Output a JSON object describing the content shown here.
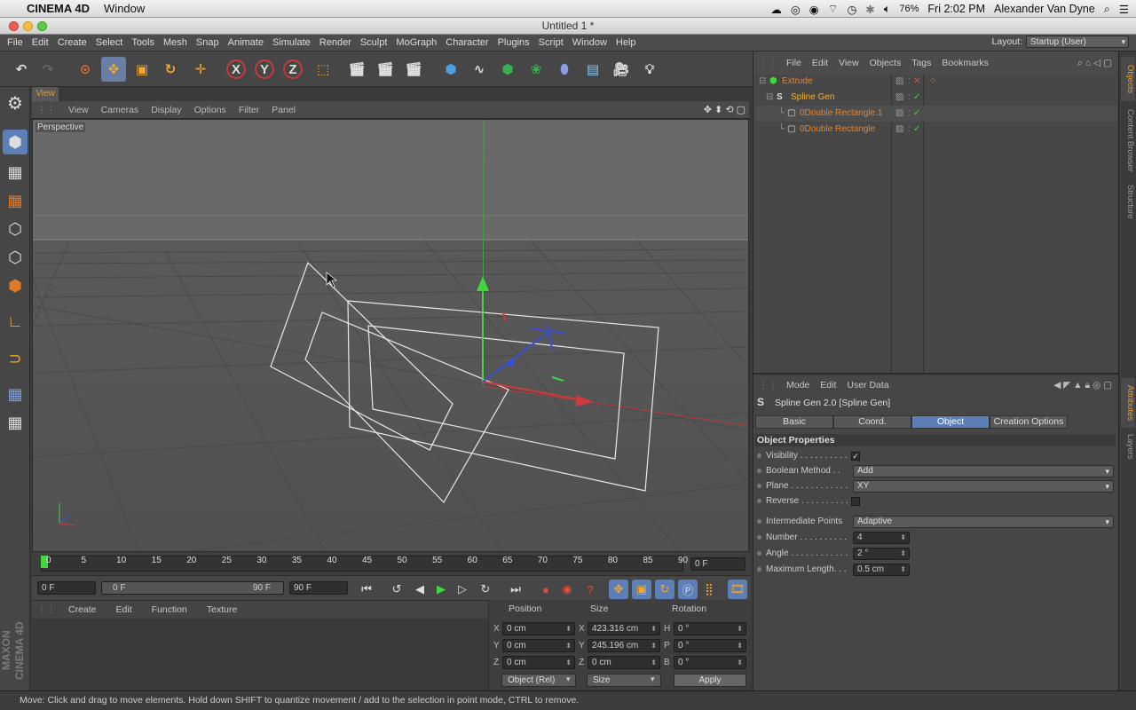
{
  "mac": {
    "app_name": "CINEMA 4D",
    "menus": [
      "Window"
    ],
    "battery": "76%",
    "clock": "Fri 2:02 PM",
    "user": "Alexander Van Dyne"
  },
  "window": {
    "title": "Untitled 1 *"
  },
  "menubar": {
    "items": [
      "File",
      "Edit",
      "Create",
      "Select",
      "Tools",
      "Mesh",
      "Snap",
      "Animate",
      "Simulate",
      "Render",
      "Sculpt",
      "MoGraph",
      "Character",
      "Plugins",
      "Script",
      "Window",
      "Help"
    ],
    "layout_label": "Layout:",
    "layout_value": "Startup (User)"
  },
  "toolbar": {
    "axis_x": "X",
    "axis_y": "Y",
    "axis_z": "Z"
  },
  "viewport": {
    "tab": "View",
    "menus": [
      "View",
      "Cameras",
      "Display",
      "Options",
      "Filter",
      "Panel"
    ],
    "camera_label": "Perspective"
  },
  "timeline": {
    "ticks": [
      "0",
      "5",
      "10",
      "15",
      "20",
      "25",
      "30",
      "35",
      "40",
      "45",
      "50",
      "55",
      "60",
      "65",
      "70",
      "75",
      "80",
      "85",
      "90"
    ],
    "current_frame": "0 F"
  },
  "transport": {
    "start": "0 F",
    "range_start": "0 F",
    "range_end": "90 F",
    "end": "90 F"
  },
  "material": {
    "menus": [
      "Create",
      "Edit",
      "Function",
      "Texture"
    ]
  },
  "coords": {
    "headers": {
      "position": "Position",
      "size": "Size",
      "rotation": "Rotation"
    },
    "axes": {
      "x": "X",
      "y": "Y",
      "z": "Z",
      "h": "H",
      "p": "P",
      "b": "B"
    },
    "position": {
      "x": "0 cm",
      "y": "0 cm",
      "z": "0 cm"
    },
    "size": {
      "x": "423.316 cm",
      "y": "245.196 cm",
      "z": "0 cm"
    },
    "rotation": {
      "h": "0 °",
      "p": "0 °",
      "b": "0 °"
    },
    "mode_dropdown": "Object (Rel)",
    "size_dropdown": "Size",
    "apply": "Apply"
  },
  "objects": {
    "menus": [
      "File",
      "Edit",
      "View",
      "Objects",
      "Tags",
      "Bookmarks"
    ],
    "rows": [
      {
        "name": "Extrude"
      },
      {
        "name": "Spline Gen"
      },
      {
        "name": "0Double Rectangle.1"
      },
      {
        "name": "0Double Rectangle"
      }
    ]
  },
  "side_tabs": {
    "objects": "Objects",
    "content_browser": "Content Browser",
    "structure": "Structure",
    "attributes": "Attributes",
    "layers": "Layers"
  },
  "attributes": {
    "menus": [
      "Mode",
      "Edit",
      "User Data"
    ],
    "title": "Spline Gen 2.0 [Spline Gen]",
    "tabs": [
      "Basic",
      "Coord.",
      "Object",
      "Creation Options"
    ],
    "section": "Object Properties",
    "visibility_label": "Visibility . . . . . . . . . .",
    "boolean_label": "Boolean Method . .",
    "boolean_value": "Add",
    "plane_label": "Plane . . . . . . . . . . . .",
    "plane_value": "XY",
    "reverse_label": "Reverse . . . . . . . . . .",
    "intermediate_label": "Intermediate Points",
    "intermediate_value": "Adaptive",
    "number_label": "Number . . . . . . . . . .",
    "number_value": "4",
    "angle_label": "Angle . . . . . . . . . . . .",
    "angle_value": "2 °",
    "maxlen_label": "Maximum Length. . .",
    "maxlen_value": "0.5 cm"
  },
  "status": {
    "text": "Move: Click and drag to move elements. Hold down SHIFT to quantize movement / add to the selection in point mode, CTRL to remove."
  },
  "branding": {
    "text": "MAXON CINEMA 4D"
  }
}
